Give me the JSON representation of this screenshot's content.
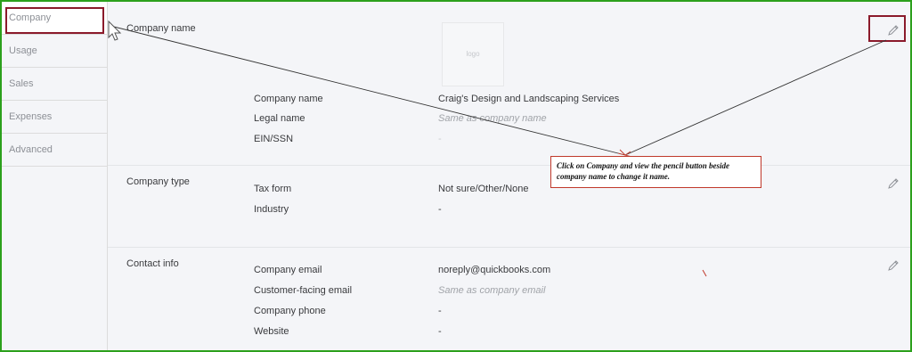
{
  "sidebar": {
    "items": [
      {
        "label": "Company"
      },
      {
        "label": "Usage"
      },
      {
        "label": "Sales"
      },
      {
        "label": "Expenses"
      },
      {
        "label": "Advanced"
      }
    ]
  },
  "company_section": {
    "title": "Company name",
    "logo_text": "logo",
    "rows": [
      {
        "label": "Company name",
        "value": "Craig's Design and Landscaping Services"
      },
      {
        "label": "Legal name",
        "value": "Same as company name"
      },
      {
        "label": "EIN/SSN",
        "value": "-"
      }
    ]
  },
  "type_section": {
    "title": "Company type",
    "rows": [
      {
        "label": "Tax form",
        "value": "Not sure/Other/None"
      },
      {
        "label": "Industry",
        "value": "-"
      }
    ]
  },
  "contact_section": {
    "title": "Contact info",
    "rows": [
      {
        "label": "Company email",
        "value": "noreply@quickbooks.com"
      },
      {
        "label": "Customer-facing email",
        "value": "Same as company email"
      },
      {
        "label": "Company phone",
        "value": "-"
      },
      {
        "label": "Website",
        "value": "-"
      }
    ]
  },
  "annotation": {
    "text": "Click on Company and view the pencil button beside company name to change it name."
  },
  "colors": {
    "frame_border": "#2ca01c",
    "highlight": "#8b1a2b",
    "callout_border": "#c0392b"
  },
  "icons": {
    "edit": "pencil-icon",
    "cursor": "mouse-pointer-icon"
  }
}
